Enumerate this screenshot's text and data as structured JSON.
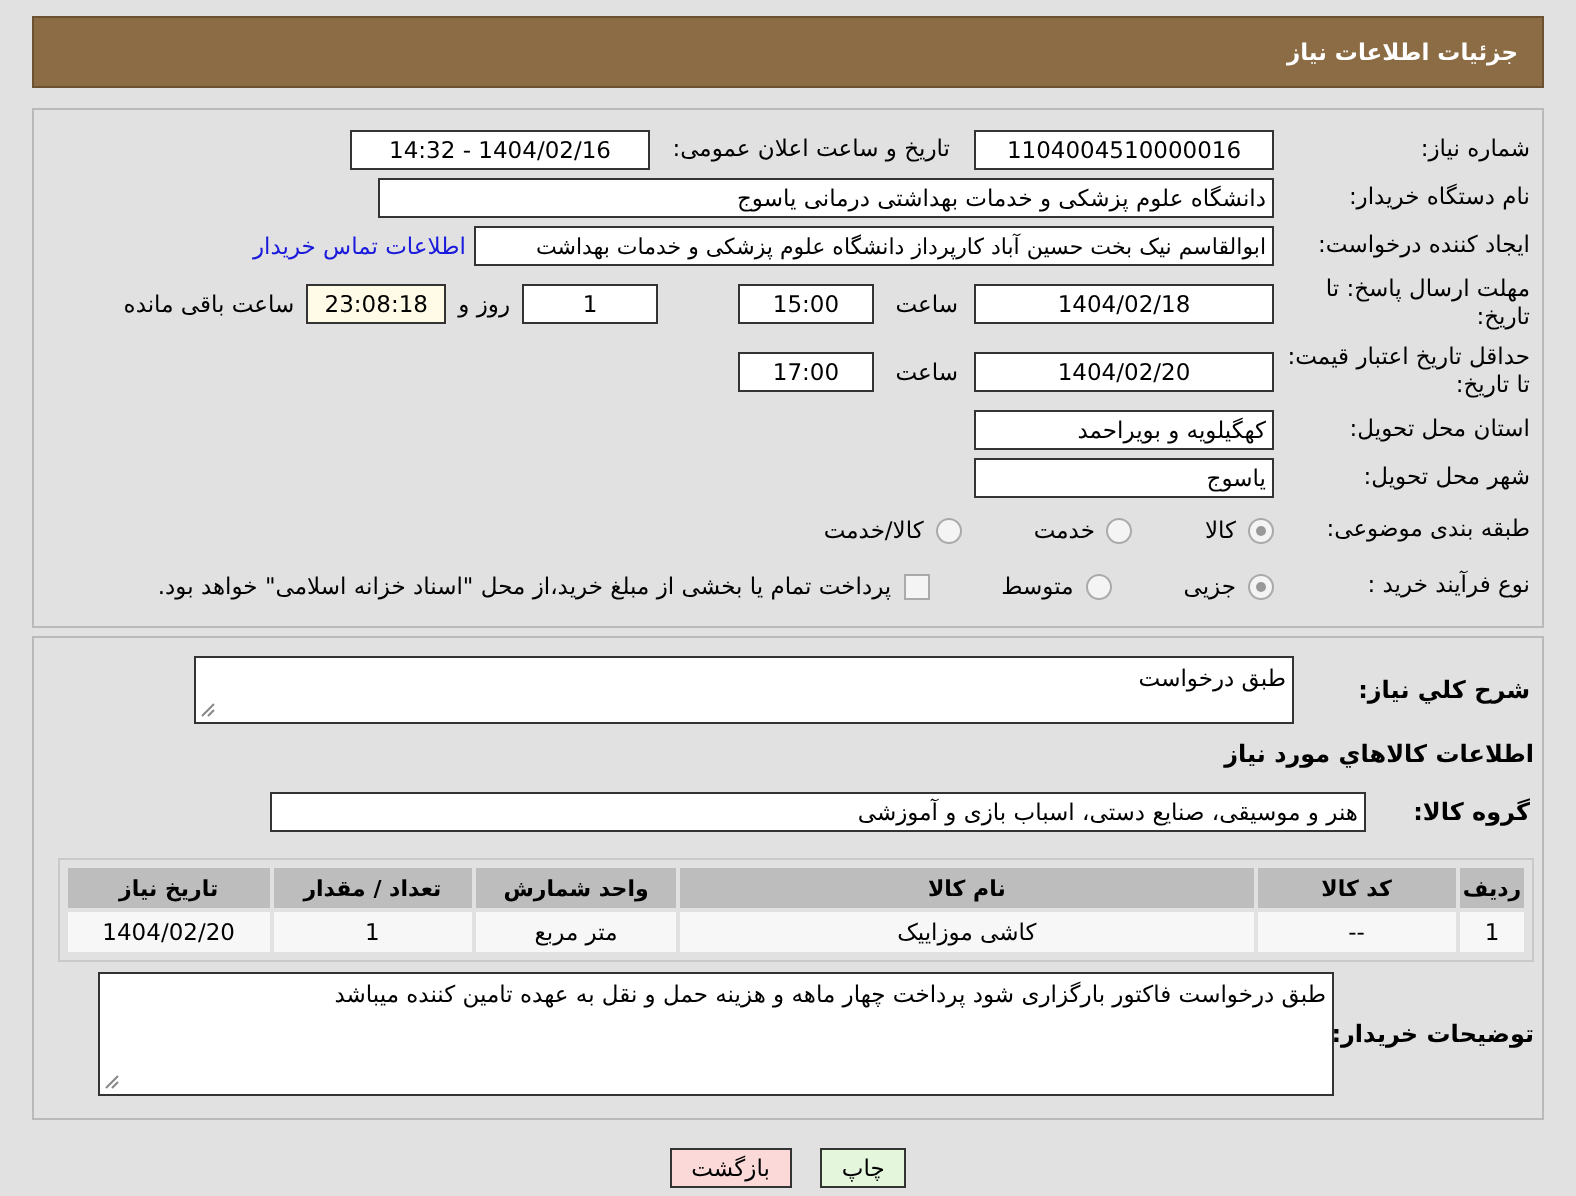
{
  "header": {
    "title": "جزئیات اطلاعات نیاز"
  },
  "need_number": {
    "label": "شماره نیاز:",
    "value": "1104004510000016"
  },
  "announce": {
    "label": "تاریخ و ساعت اعلان عمومی:",
    "value": "1404/02/16 - 14:32"
  },
  "buyer_org": {
    "label": "نام دستگاه خریدار:",
    "value": "دانشگاه علوم پزشکی و خدمات بهداشتی  درمانی یاسوج"
  },
  "requester": {
    "label": "ایجاد کننده درخواست:",
    "value": "ابوالقاسم نیک بخت حسین آباد کارپرداز دانشگاه علوم پزشکی و خدمات بهداشت",
    "link": "اطلاعات تماس خریدار"
  },
  "deadline": {
    "label": "مهلت ارسال پاسخ: تا تاریخ:",
    "date": "1404/02/18",
    "time_label": "ساعت",
    "time": "15:00",
    "days": "1",
    "days_label": "روز و",
    "remaining": "23:08:18",
    "remaining_label": "ساعت باقی مانده"
  },
  "validity": {
    "label": "حداقل تاریخ اعتبار قیمت: تا تاریخ:",
    "date": "1404/02/20",
    "time_label": "ساعت",
    "time": "17:00"
  },
  "province": {
    "label": "استان محل تحویل:",
    "value": "کهگیلویه و بویراحمد"
  },
  "city": {
    "label": "شهر محل تحویل:",
    "value": "یاسوج"
  },
  "category": {
    "label": "طبقه بندی موضوعی:",
    "options": [
      {
        "label": "کالا",
        "selected": true
      },
      {
        "label": "خدمت",
        "selected": false
      },
      {
        "label": "کالا/خدمت",
        "selected": false
      }
    ]
  },
  "process": {
    "label": "نوع فرآیند خرید :",
    "options": [
      {
        "label": "جزیی",
        "selected": true
      },
      {
        "label": "متوسط",
        "selected": false
      }
    ],
    "treasury": {
      "label": "پرداخت تمام یا بخشی از مبلغ خرید،از محل \"اسناد خزانه اسلامی\" خواهد بود.",
      "checked": false
    }
  },
  "summary": {
    "label": "شرح کلي نياز:",
    "value": "طبق درخواست"
  },
  "goods_title": "اطلاعات کالاهاي مورد نياز",
  "goods_group": {
    "label": "گروه کالا:",
    "value": "هنر و موسیقی، صنایع دستی، اسباب بازی و آموزشی"
  },
  "table": {
    "columns": [
      "ردیف",
      "کد کالا",
      "نام کالا",
      "واحد شمارش",
      "تعداد / مقدار",
      "تاریخ نیاز"
    ],
    "rows": [
      [
        "1",
        "--",
        "کاشی موزاییک",
        "متر مربع",
        "1",
        "1404/02/20"
      ]
    ]
  },
  "buyer_notes": {
    "label": "توضیحات خریدار:",
    "value": "طبق درخواست فاکتور بارگزاری شود پرداخت چهار ماهه و هزینه حمل و نقل به عهده تامین کننده میباشد"
  },
  "buttons": [
    {
      "label": "چاپ",
      "kind": "print"
    },
    {
      "label": "بازگشت",
      "kind": "back"
    }
  ]
}
